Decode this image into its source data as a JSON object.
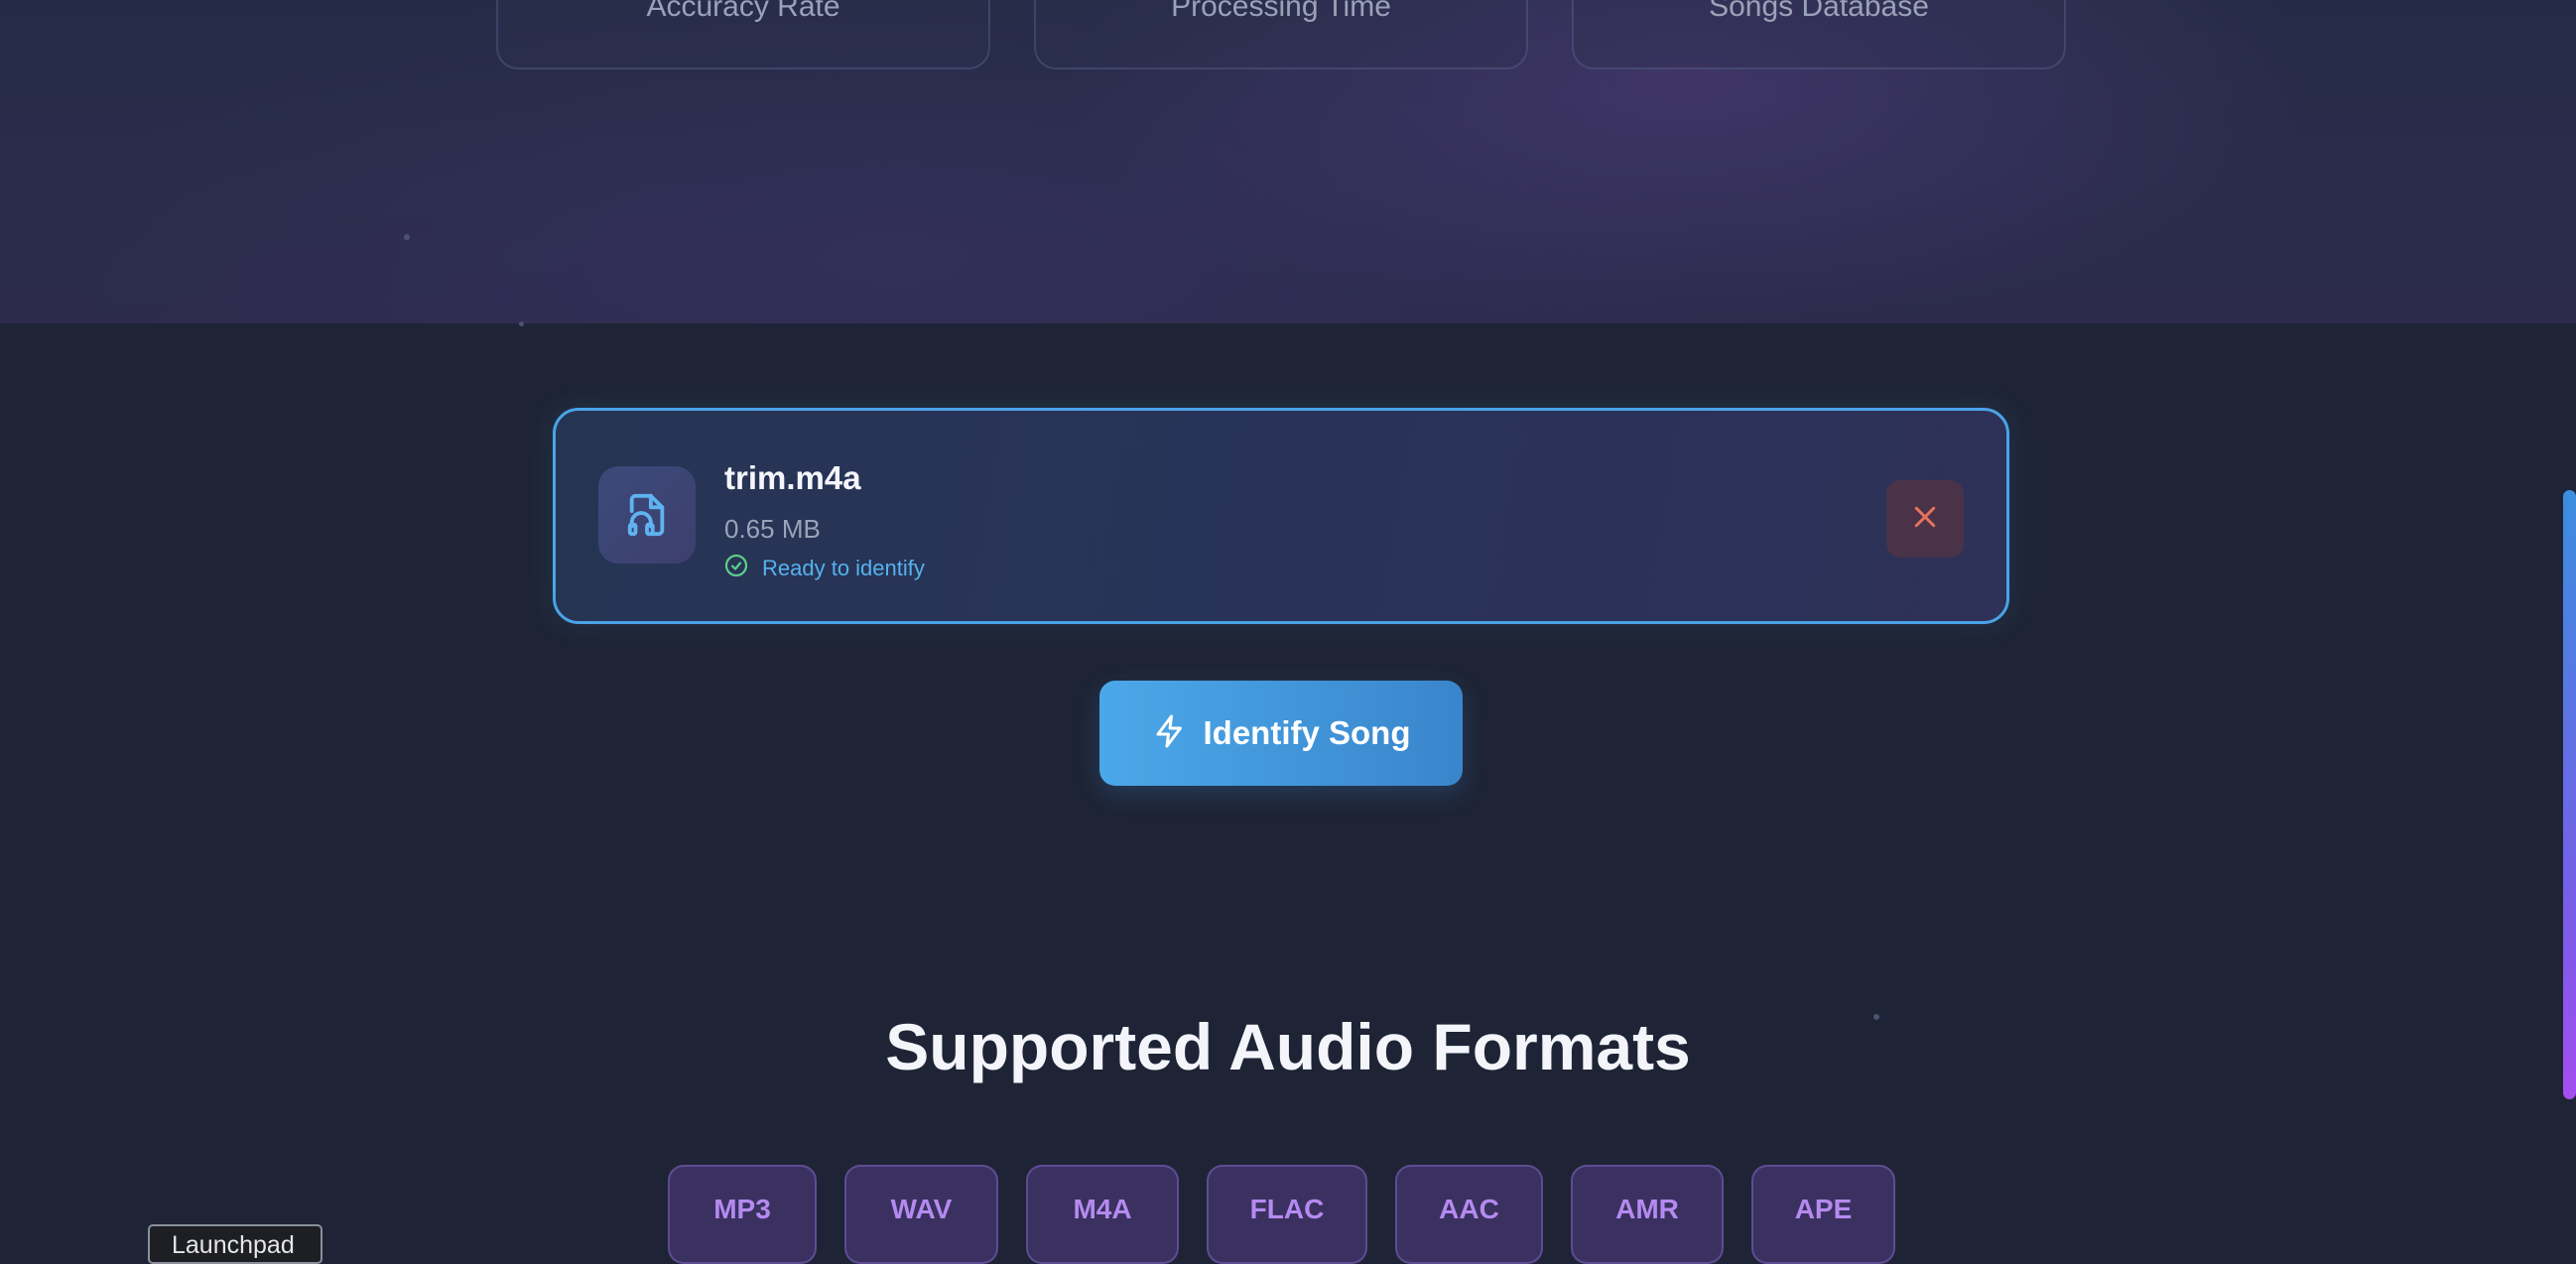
{
  "stats": [
    {
      "label": "Accuracy Rate"
    },
    {
      "label": "Processing Time"
    },
    {
      "label": "Songs Database"
    }
  ],
  "file": {
    "name": "trim.m4a",
    "size": "0.65 MB",
    "status": "Ready to identify",
    "icon": "file-audio-icon",
    "status_icon": "check-circle-icon",
    "remove_icon": "close-icon"
  },
  "identify_button": {
    "label": "Identify Song",
    "icon": "lightning-icon"
  },
  "formats": {
    "title": "Supported Audio Formats",
    "items": [
      "MP3",
      "WAV",
      "M4A",
      "FLAC",
      "AAC",
      "AMR",
      "APE"
    ]
  },
  "tooltip": {
    "label": "Launchpad"
  },
  "colors": {
    "accent_blue": "#4aa3e8",
    "accent_purple": "#b58af0",
    "status_green": "#5ccf8a",
    "remove_red": "#e8735a"
  }
}
